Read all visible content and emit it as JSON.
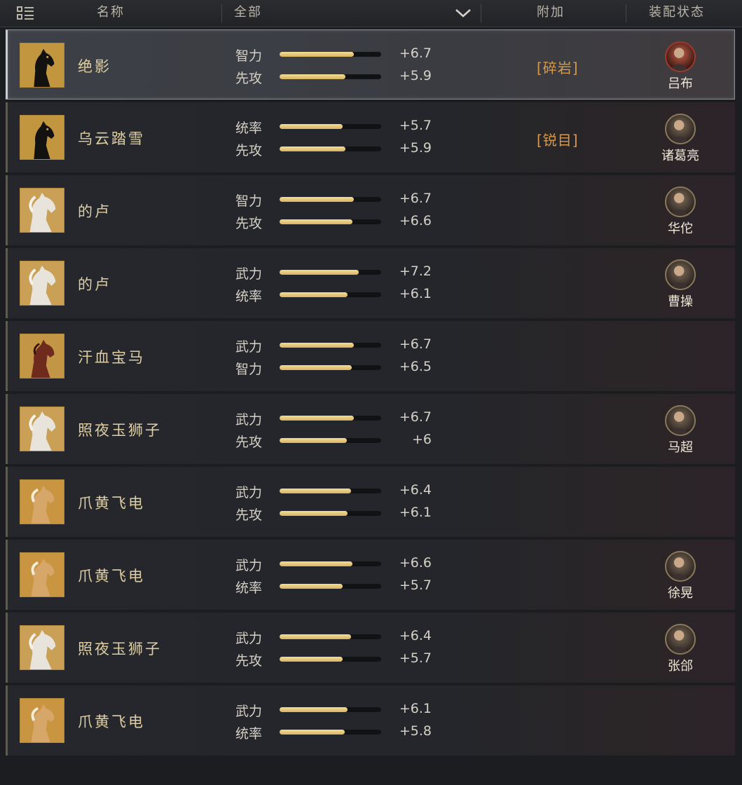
{
  "header": {
    "col_name": "名称",
    "filter_value": "全部",
    "col_bonus": "附加",
    "col_status": "装配状态"
  },
  "colors": {
    "bar_fill": "#e9c87a",
    "bonus_text": "#d89a4a",
    "name_text": "#e0cfa2"
  },
  "rows": [
    {
      "name": "绝影",
      "icon": "black-horse-icon",
      "selected": true,
      "stats": [
        {
          "label": "智力",
          "value": "+6.7",
          "fill": 0.73
        },
        {
          "label": "先攻",
          "value": "+5.9",
          "fill": 0.65
        }
      ],
      "bonus": "[碎岩]",
      "general": "吕布"
    },
    {
      "name": "乌云踏雪",
      "icon": "black-horse-icon",
      "stats": [
        {
          "label": "统率",
          "value": "+5.7",
          "fill": 0.62
        },
        {
          "label": "先攻",
          "value": "+5.9",
          "fill": 0.65
        }
      ],
      "bonus": "[锐目]",
      "general": "诸葛亮"
    },
    {
      "name": "的卢",
      "icon": "white-horse-icon",
      "stats": [
        {
          "label": "智力",
          "value": "+6.7",
          "fill": 0.73
        },
        {
          "label": "先攻",
          "value": "+6.6",
          "fill": 0.72
        }
      ],
      "bonus": "",
      "general": "华佗"
    },
    {
      "name": "的卢",
      "icon": "white-horse-icon",
      "stats": [
        {
          "label": "武力",
          "value": "+7.2",
          "fill": 0.78
        },
        {
          "label": "统率",
          "value": "+6.1",
          "fill": 0.67
        }
      ],
      "bonus": "",
      "general": "曹操"
    },
    {
      "name": "汗血宝马",
      "icon": "red-horse-icon",
      "stats": [
        {
          "label": "武力",
          "value": "+6.7",
          "fill": 0.73
        },
        {
          "label": "智力",
          "value": "+6.5",
          "fill": 0.71
        }
      ],
      "bonus": "",
      "general": ""
    },
    {
      "name": "照夜玉狮子",
      "icon": "white-horse-icon",
      "stats": [
        {
          "label": "武力",
          "value": "+6.7",
          "fill": 0.73
        },
        {
          "label": "先攻",
          "value": "+6",
          "fill": 0.66
        }
      ],
      "bonus": "",
      "general": "马超"
    },
    {
      "name": "爪黄飞电",
      "icon": "yellow-horse-icon",
      "stats": [
        {
          "label": "武力",
          "value": "+6.4",
          "fill": 0.7
        },
        {
          "label": "先攻",
          "value": "+6.1",
          "fill": 0.67
        }
      ],
      "bonus": "",
      "general": ""
    },
    {
      "name": "爪黄飞电",
      "icon": "yellow-horse-icon",
      "stats": [
        {
          "label": "武力",
          "value": "+6.6",
          "fill": 0.72
        },
        {
          "label": "统率",
          "value": "+5.7",
          "fill": 0.62
        }
      ],
      "bonus": "",
      "general": "徐晃"
    },
    {
      "name": "照夜玉狮子",
      "icon": "white-horse-icon",
      "stats": [
        {
          "label": "武力",
          "value": "+6.4",
          "fill": 0.7
        },
        {
          "label": "先攻",
          "value": "+5.7",
          "fill": 0.62
        }
      ],
      "bonus": "",
      "general": "张郃"
    },
    {
      "name": "爪黄飞电",
      "icon": "yellow-horse-icon",
      "stats": [
        {
          "label": "武力",
          "value": "+6.1",
          "fill": 0.67
        },
        {
          "label": "统率",
          "value": "+5.8",
          "fill": 0.64
        }
      ],
      "bonus": "",
      "general": ""
    }
  ]
}
